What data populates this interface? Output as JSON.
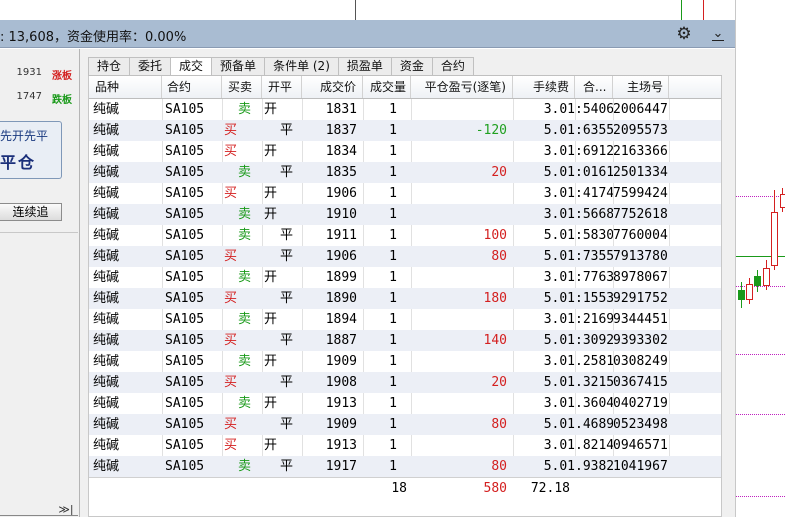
{
  "titlebar": {
    "text": ": 13,608，资金使用率：0.00%"
  },
  "icons": {
    "settings": "gear-icon",
    "collapse": "chevron-down-icon"
  },
  "left_panel": {
    "quotes": [
      {
        "value": "1931",
        "tag": "涨板",
        "color": "#d42020"
      },
      {
        "value": "1747",
        "tag": "跌板",
        "color": "#1a9a1a"
      }
    ],
    "mode_small": "先开先平",
    "mode_big": "平仓",
    "continuous_button": "连续追",
    "scroll_glyph": "≫|"
  },
  "tabs": [
    {
      "label": "持仓",
      "active": false
    },
    {
      "label": "委托",
      "active": false
    },
    {
      "label": "成交",
      "active": true
    },
    {
      "label": "预备单",
      "active": false
    },
    {
      "label": "条件单 (2)",
      "active": false
    },
    {
      "label": "损盈单",
      "active": false
    },
    {
      "label": "资金",
      "active": false
    },
    {
      "label": "合约",
      "active": false
    }
  ],
  "columns": [
    "品种",
    "合约",
    "买卖",
    "开平",
    "成交价",
    "成交量",
    "平仓盈亏(逐笔)",
    "手续费",
    "合...",
    "主场号"
  ],
  "rows": [
    {
      "variety": "纯碱",
      "contract": "SA105",
      "side": "卖",
      "oc": "开",
      "price": "1831",
      "qty": "1",
      "pnl": "",
      "fee": "3.01",
      "cno": ":5406",
      "main_no": "2006447"
    },
    {
      "variety": "纯碱",
      "contract": "SA105",
      "side": "买",
      "oc": "平",
      "price": "1837",
      "qty": "1",
      "pnl": "-120",
      "fee": "5.01",
      "cno": ":6355",
      "main_no": "2095573"
    },
    {
      "variety": "纯碱",
      "contract": "SA105",
      "side": "买",
      "oc": "开",
      "price": "1834",
      "qty": "1",
      "pnl": "",
      "fee": "3.01",
      "cno": ":6912",
      "main_no": "2163366"
    },
    {
      "variety": "纯碱",
      "contract": "SA105",
      "side": "卖",
      "oc": "平",
      "price": "1835",
      "qty": "1",
      "pnl": "20",
      "fee": "5.01",
      "cno": ":0161",
      "main_no": "2501334"
    },
    {
      "variety": "纯碱",
      "contract": "SA105",
      "side": "买",
      "oc": "开",
      "price": "1906",
      "qty": "1",
      "pnl": "",
      "fee": "3.01",
      "cno": ":4174",
      "main_no": "7599424"
    },
    {
      "variety": "纯碱",
      "contract": "SA105",
      "side": "卖",
      "oc": "开",
      "price": "1910",
      "qty": "1",
      "pnl": "",
      "fee": "3.01",
      "cno": ":5668",
      "main_no": "7752618"
    },
    {
      "variety": "纯碱",
      "contract": "SA105",
      "side": "卖",
      "oc": "平",
      "price": "1911",
      "qty": "1",
      "pnl": "100",
      "fee": "5.01",
      "cno": ":5830",
      "main_no": "7760004"
    },
    {
      "variety": "纯碱",
      "contract": "SA105",
      "side": "买",
      "oc": "平",
      "price": "1906",
      "qty": "1",
      "pnl": "80",
      "fee": "5.01",
      "cno": ":7355",
      "main_no": "7913780"
    },
    {
      "variety": "纯碱",
      "contract": "SA105",
      "side": "卖",
      "oc": "开",
      "price": "1899",
      "qty": "1",
      "pnl": "",
      "fee": "3.01",
      "cno": ":7763",
      "main_no": "8978067"
    },
    {
      "variety": "纯碱",
      "contract": "SA105",
      "side": "买",
      "oc": "平",
      "price": "1890",
      "qty": "1",
      "pnl": "180",
      "fee": "5.01",
      "cno": ":1553",
      "main_no": "9291752"
    },
    {
      "variety": "纯碱",
      "contract": "SA105",
      "side": "卖",
      "oc": "开",
      "price": "1894",
      "qty": "1",
      "pnl": "",
      "fee": "3.01",
      "cno": ":2169",
      "main_no": "9344451"
    },
    {
      "variety": "纯碱",
      "contract": "SA105",
      "side": "买",
      "oc": "平",
      "price": "1887",
      "qty": "1",
      "pnl": "140",
      "fee": "5.01",
      "cno": ":3092",
      "main_no": "9393302"
    },
    {
      "variety": "纯碱",
      "contract": "SA105",
      "side": "卖",
      "oc": "开",
      "price": "1909",
      "qty": "1",
      "pnl": "",
      "fee": "3.01",
      "cno": ".2581",
      "main_no": "0308249"
    },
    {
      "variety": "纯碱",
      "contract": "SA105",
      "side": "买",
      "oc": "平",
      "price": "1908",
      "qty": "1",
      "pnl": "20",
      "fee": "5.01",
      "cno": ".3215",
      "main_no": "0367415"
    },
    {
      "variety": "纯碱",
      "contract": "SA105",
      "side": "卖",
      "oc": "开",
      "price": "1913",
      "qty": "1",
      "pnl": "",
      "fee": "3.01",
      "cno": ".3604",
      "main_no": "0402719"
    },
    {
      "variety": "纯碱",
      "contract": "SA105",
      "side": "买",
      "oc": "平",
      "price": "1909",
      "qty": "1",
      "pnl": "80",
      "fee": "5.01",
      "cno": ".4689",
      "main_no": "0523498"
    },
    {
      "variety": "纯碱",
      "contract": "SA105",
      "side": "买",
      "oc": "开",
      "price": "1913",
      "qty": "1",
      "pnl": "",
      "fee": "3.01",
      "cno": ".8214",
      "main_no": "0946571"
    },
    {
      "variety": "纯碱",
      "contract": "SA105",
      "side": "卖",
      "oc": "平",
      "price": "1917",
      "qty": "1",
      "pnl": "80",
      "fee": "5.01",
      "cno": ".9382",
      "main_no": "1041967"
    }
  ],
  "totals": {
    "qty": "18",
    "pnl": "580",
    "fee": "72.18"
  },
  "colors": {
    "buy": "#d42020",
    "sell": "#1a9a1a",
    "titlebar": "#a9bcd2",
    "row_alt": "#eceff6"
  }
}
